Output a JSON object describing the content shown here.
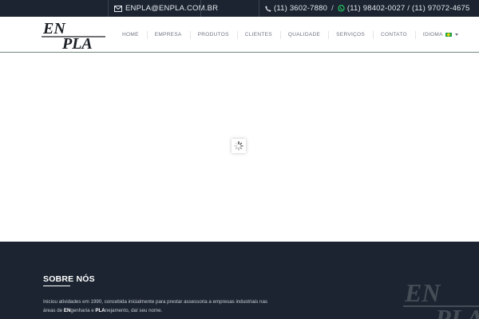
{
  "topbar": {
    "email": "ENPLA@ENPLA.COM.BR",
    "phone": "(11) 3602-7880",
    "separator": "/",
    "whatsapp": "(11) 98402-0027 / (11) 97072-4675",
    "icons": {
      "email": "envelope-icon",
      "phone": "phone-icon",
      "whatsapp": "whatsapp-icon"
    }
  },
  "header": {
    "logo": {
      "line1": "EN",
      "line2": "PLA"
    },
    "nav": [
      "HOME",
      "EMPRESA",
      "PRODUTOS",
      "CLIENTES",
      "QUALIDADE",
      "SERVIÇOS",
      "CONTATO"
    ],
    "language": {
      "label": "IDIOMA",
      "flag": "brazil-flag-icon"
    }
  },
  "content": {
    "loader": "spinner-icon"
  },
  "footer": {
    "title": "SOBRE NÓS",
    "para_line1": "Iniciou atividades em 1990, concebida inicialmente para prestar assessoria a empresas industriais nas",
    "para_pre": "áreas de ",
    "para_en": "EN",
    "para_mid": "genharia e ",
    "para_pla": "PLA",
    "para_end": "nejamento, daí seu nome."
  },
  "colors": {
    "dark": "#1b2430",
    "white": "#ffffff",
    "whatsapp_green": "#25d366",
    "nav_text": "#6d7480"
  }
}
